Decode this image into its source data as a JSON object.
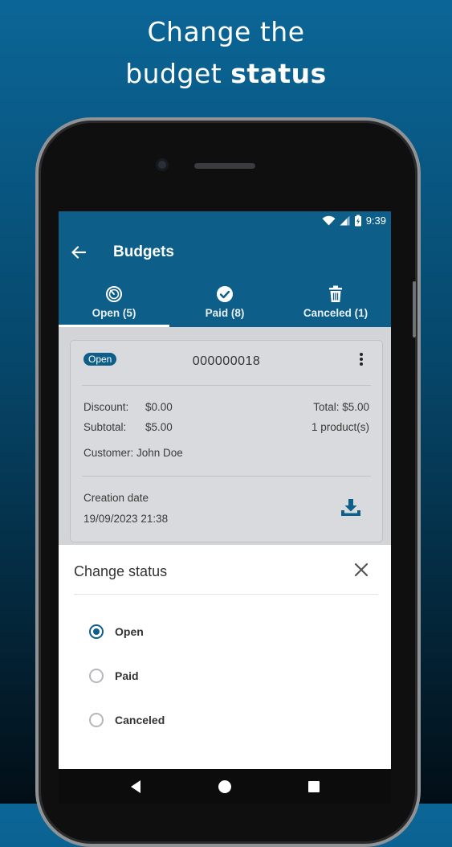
{
  "headline": {
    "line1": "Change the",
    "line2_prefix": "budget ",
    "line2_bold": "status"
  },
  "statusbar": {
    "time": "9:39",
    "icons": [
      "wifi-icon",
      "signal-icon",
      "battery-charging-icon"
    ]
  },
  "appbar": {
    "title": "Budgets",
    "back_icon": "arrow-left-icon"
  },
  "tabs": [
    {
      "label": "Open (5)",
      "icon": "timer-icon",
      "active": true
    },
    {
      "label": "Paid (8)",
      "icon": "check-circle-icon",
      "active": false
    },
    {
      "label": "Canceled (1)",
      "icon": "trash-icon",
      "active": false
    }
  ],
  "card": {
    "badge": "Open",
    "number": "000000018",
    "discount_label": "Discount:",
    "discount_value": "$0.00",
    "subtotal_label": "Subtotal:",
    "subtotal_value": "$5.00",
    "total": "Total: $5.00",
    "products": "1 product(s)",
    "customer": "Customer: John Doe",
    "creation_label": "Creation date",
    "creation_value": "19/09/2023 21:38"
  },
  "sheet": {
    "title": "Change status",
    "options": [
      {
        "label": "Open",
        "selected": true
      },
      {
        "label": "Paid",
        "selected": false
      },
      {
        "label": "Canceled",
        "selected": false
      }
    ]
  },
  "colors": {
    "primary": "#0d5e88",
    "accent_white": "#ffffff",
    "screen_bg": "#d3d4d7"
  }
}
